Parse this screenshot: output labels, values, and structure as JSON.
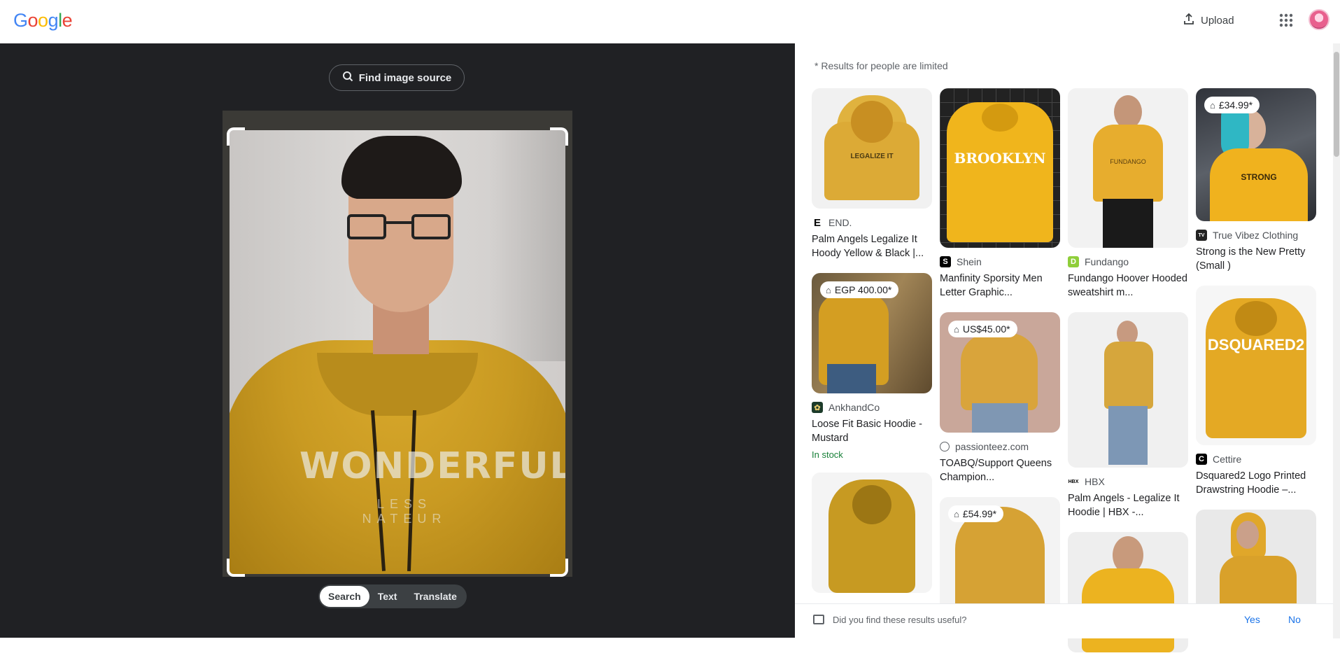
{
  "header": {
    "logo_text": "Google",
    "upload_label": "Upload"
  },
  "lens": {
    "find_source_label": "Find image source",
    "modes": [
      "Search",
      "Text",
      "Translate"
    ],
    "active_mode": "Search",
    "hoodie_print": "WONDERFUL",
    "hoodie_sub": "LESS NATEUR"
  },
  "results": {
    "notice": "* Results for people are limited",
    "columns": [
      [
        {
          "source": "END.",
          "title": "Palm Angels Legalize It Hoody Yellow & Black |...",
          "price": "",
          "stock": "",
          "icon": "E"
        },
        {
          "source": "AnkhandCo",
          "title": "Loose Fit Basic Hoodie - Mustard",
          "price": "EGP 400.00*",
          "stock": "In stock",
          "icon": "A"
        },
        {
          "source": "",
          "title": "",
          "price": "",
          "stock": "",
          "icon": ""
        }
      ],
      [
        {
          "source": "Shein",
          "title": "Manfinity Sporsity Men Letter Graphic...",
          "price": "",
          "stock": "",
          "icon": "S"
        },
        {
          "source": "passionteez.com",
          "title": "TOABQ/Support Queens Champion...",
          "price": "US$45.00*",
          "stock": "",
          "icon": "globe"
        },
        {
          "source": "",
          "title": "",
          "price": "£54.99*",
          "stock": "",
          "icon": ""
        }
      ],
      [
        {
          "source": "Fundango",
          "title": "Fundango Hoover Hooded sweatshirt m...",
          "price": "",
          "stock": "",
          "icon": "fD"
        },
        {
          "source": "HBX",
          "title": "Palm Angels - Legalize It Hoodie | HBX -...",
          "price": "",
          "stock": "",
          "icon": "HBX"
        },
        {
          "source": "",
          "title": "",
          "price": "",
          "stock": "",
          "icon": ""
        }
      ],
      [
        {
          "source": "True Vibez Clothing",
          "title": "Strong is the New Pretty (Small )",
          "price": "£34.99*",
          "stock": "",
          "icon": "TV"
        },
        {
          "source": "Cettire",
          "title": "Dsquared2 Logo Printed Drawstring Hoodie –...",
          "price": "",
          "stock": "",
          "icon": "C"
        },
        {
          "source": "",
          "title": "",
          "price": "",
          "stock": "",
          "icon": ""
        }
      ]
    ],
    "thumb_text": [
      "LEGALIZE IT",
      "BROOKLYN",
      "FUNDANGO",
      "STRONG",
      "",
      "",
      "",
      "DSQUARED2",
      "",
      "",
      "",
      ""
    ]
  },
  "feedback": {
    "question": "Did you find these results useful?",
    "yes": "Yes",
    "no": "No"
  }
}
